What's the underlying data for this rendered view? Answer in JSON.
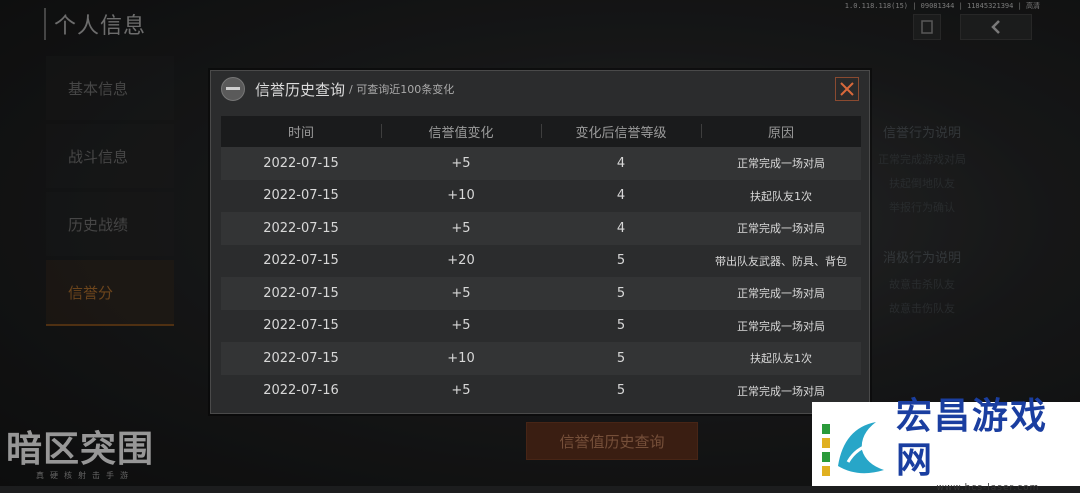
{
  "header": {
    "title": "个人信息",
    "version": "1.0.118.118(15) | 09081344 | 11845321394 | 高清"
  },
  "nav": {
    "items": [
      {
        "label": "基本信息"
      },
      {
        "label": "战斗信息"
      },
      {
        "label": "历史战绩"
      },
      {
        "label": "信誉分"
      }
    ]
  },
  "side": {
    "positive_title": "信誉行为说明",
    "positive_lines": [
      "正常完成游戏对局",
      "扶起倒地队友",
      "举报行为确认"
    ],
    "negative_title": "消极行为说明",
    "negative_lines": [
      "故意击杀队友",
      "故意击伤队友"
    ]
  },
  "history_button": "信誉值历史查询",
  "logo": {
    "main": "暗区突围",
    "sub": "真硬核射击手游"
  },
  "watermark": {
    "title": "宏昌游戏网",
    "url": "www.hcs-laser.com"
  },
  "modal": {
    "title": "信誉历史查询",
    "subtitle": "/ 可查询近100条变化",
    "columns": [
      "时间",
      "信誉值变化",
      "变化后信誉等级",
      "原因"
    ],
    "rows": [
      {
        "date": "2022-07-15",
        "change": "+5",
        "level": "4",
        "reason": "正常完成一场对局"
      },
      {
        "date": "2022-07-15",
        "change": "+10",
        "level": "4",
        "reason": "扶起队友1次"
      },
      {
        "date": "2022-07-15",
        "change": "+5",
        "level": "4",
        "reason": "正常完成一场对局"
      },
      {
        "date": "2022-07-15",
        "change": "+20",
        "level": "5",
        "reason": "带出队友武器、防具、背包"
      },
      {
        "date": "2022-07-15",
        "change": "+5",
        "level": "5",
        "reason": "正常完成一场对局"
      },
      {
        "date": "2022-07-15",
        "change": "+5",
        "level": "5",
        "reason": "正常完成一场对局"
      },
      {
        "date": "2022-07-15",
        "change": "+10",
        "level": "5",
        "reason": "扶起队友1次"
      },
      {
        "date": "2022-07-16",
        "change": "+5",
        "level": "5",
        "reason": "正常完成一场对局"
      }
    ]
  }
}
